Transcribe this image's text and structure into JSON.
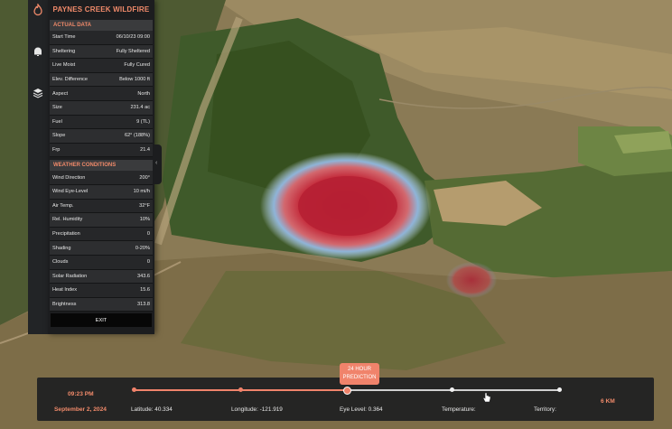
{
  "panel": {
    "title": "PAYNES CREEK WILDFIRE",
    "actual_header": "ACTUAL DATA",
    "actual_rows": [
      {
        "label": "Start Time",
        "value": "06/10/23 09:00"
      },
      {
        "label": "Sheltering",
        "value": "Fully Sheltered"
      },
      {
        "label": "Live Moist",
        "value": "Fully Cured"
      },
      {
        "label": "Elev. Difference",
        "value": "Below 1000 ft"
      },
      {
        "label": "Aspect",
        "value": "North"
      },
      {
        "label": "Size",
        "value": "231.4 ac"
      },
      {
        "label": "Fuel",
        "value": "9 (TL)"
      },
      {
        "label": "Slope",
        "value": "62° (188%)"
      },
      {
        "label": "Frp",
        "value": "21.4"
      }
    ],
    "weather_header": "WEATHER CONDITIONS",
    "weather_rows": [
      {
        "label": "Wind Direction",
        "value": "200°"
      },
      {
        "label": "Wind Eye-Level",
        "value": "10 mi/h"
      },
      {
        "label": "Air Temp.",
        "value": "32°F"
      },
      {
        "label": "Rel. Humidity",
        "value": "10%"
      },
      {
        "label": "Precipitation",
        "value": "0"
      },
      {
        "label": "Shading",
        "value": "0-20%"
      },
      {
        "label": "Clouds",
        "value": "0"
      },
      {
        "label": "Solar Radiation",
        "value": "343.6"
      },
      {
        "label": "Heat Index",
        "value": "15.6"
      },
      {
        "label": "Brightness",
        "value": "313.8"
      }
    ],
    "exit_label": "EXIT"
  },
  "rail": {
    "icons": [
      "fire-icon",
      "bell-icon",
      "layers-icon"
    ]
  },
  "timeline": {
    "time": "09:23 PM",
    "date": "September 2, 2024",
    "prediction_line1": "24 HOUR",
    "prediction_line2": "PREDICTION",
    "progress": 0.5,
    "latitude": "Latitude: 40.334",
    "longitude": "Longitude: -121.919",
    "eye_level": "Eye Level: 0.364",
    "temperature": "Temperature:",
    "territory": "Territory:",
    "distance": "6 KM"
  },
  "colors": {
    "accent": "#f08a6a",
    "panel_bg": "#1c1d1f",
    "fire_core": "#c8283a",
    "fire_edge": "#5a8ec8"
  }
}
